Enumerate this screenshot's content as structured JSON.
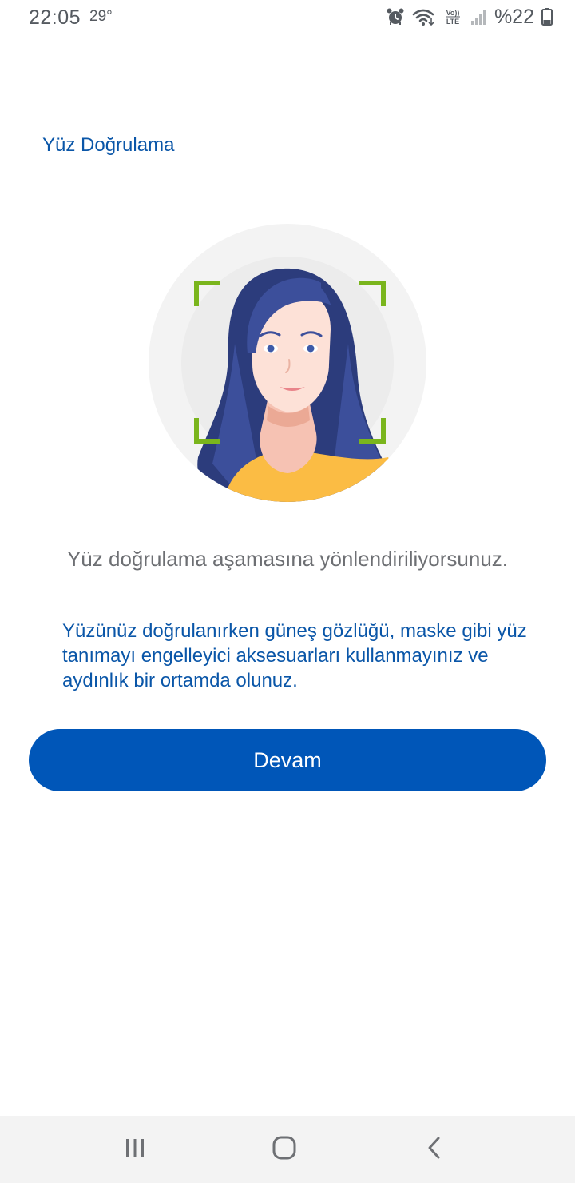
{
  "status_bar": {
    "time": "22:05",
    "temperature": "29°",
    "battery": "%22",
    "icons": [
      "alarm-icon",
      "wifi-icon",
      "volte-icon",
      "signal-icon",
      "battery-icon"
    ]
  },
  "header": {
    "title": "Yüz Doğrulama"
  },
  "illustration": {
    "icon": "face-verification-illustration",
    "colors": {
      "circle": "#f3f3f3",
      "hair": "#3c4f9b",
      "skin": "#fde1d7",
      "shirt": "#fbbc44",
      "frame": "#7ab51d"
    }
  },
  "main": {
    "lead_text": "Yüz doğrulama aşamasına yönlendiriliyorsunuz.",
    "info_text": "Yüzünüz doğrulanırken güneş gözlüğü, maske gibi yüz tanımayı engelleyici aksesuarları kullanmayınız ve aydınlık bir ortamda olunuz.",
    "continue_label": "Devam"
  },
  "nav_bar": {
    "recent_icon": "recent-apps-icon",
    "home_icon": "home-icon",
    "back_icon": "back-icon"
  },
  "colors": {
    "accent": "#0056b8",
    "text_blue": "#0a56a8"
  }
}
